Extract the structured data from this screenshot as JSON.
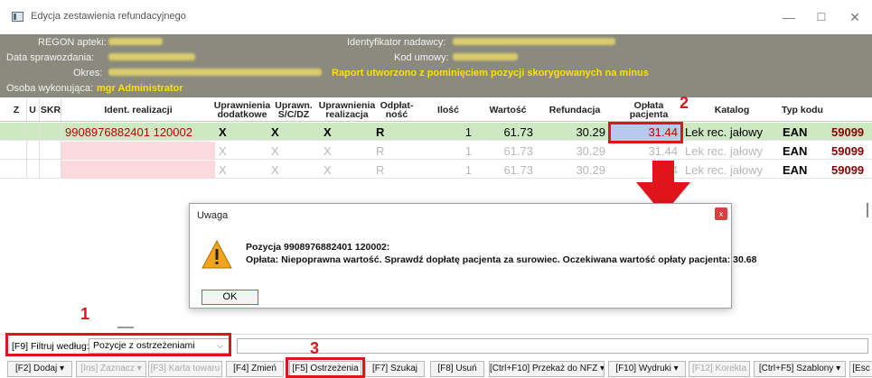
{
  "window": {
    "title": "Edycja zestawienia refundacyjnego",
    "minimize": "—",
    "maximize": "☐",
    "close": "✕"
  },
  "info": {
    "regon_label": "REGON apteki:",
    "data_label": "Data sprawozdania:",
    "okres_label": "Okres:",
    "okres_note": "Raport utworzono z pominięciem pozycji skorygowanych na minus",
    "osoba_label": "Osoba wykonująca:",
    "osoba_value": "mgr Administrator",
    "nadawca_label": "Identyfikator nadawcy:",
    "umowa_label": "Kod umowy:"
  },
  "grid": {
    "headers": {
      "z": "Z",
      "u": "U",
      "skr": "SKR",
      "ident": "Ident. realizacji",
      "upr_dod": "Uprawnienia dodatkowe",
      "upr_scdz": "Uprawn. S/C/DZ",
      "upr_real": "Uprawnienia realizacja",
      "odplat": "Odpłat-ność",
      "ilosc": "Ilość",
      "wartosc": "Wartość",
      "refundacja": "Refundacja",
      "oplata": "Opłata pacjenta",
      "katalog": "Katalog",
      "typ": "Typ kodu"
    },
    "rows": [
      {
        "ident": "9908976882401  120002",
        "upr_dod": "X",
        "upr_scdz": "X",
        "upr_real": "X",
        "odplat": "R",
        "ilosc": "1",
        "wartosc": "61.73",
        "refundacja": "30.29",
        "oplata": "31.44",
        "katalog": "Lek rec. jałowy",
        "typ": "EAN",
        "kod": "59099"
      },
      {
        "ident": "",
        "upr_dod": "X",
        "upr_scdz": "X",
        "upr_real": "X",
        "odplat": "R",
        "ilosc": "1",
        "wartosc": "61.73",
        "refundacja": "30.29",
        "oplata": "31.44",
        "katalog": "Lek rec. jałowy",
        "typ": "EAN",
        "kod": "59099"
      },
      {
        "ident": "",
        "upr_dod": "X",
        "upr_scdz": "X",
        "upr_real": "X",
        "odplat": "R",
        "ilosc": "1",
        "wartosc": "61.73",
        "refundacja": "30.29",
        "oplata": "4",
        "katalog": "Lek rec. jałowy",
        "typ": "EAN",
        "kod": "59099"
      }
    ]
  },
  "callouts": {
    "one": "1",
    "two": "2",
    "three": "3"
  },
  "dialog": {
    "title": "Uwaga",
    "close": "x",
    "line1": "Pozycja 9908976882401  120002:",
    "line2": "Opłata: Niepoprawna wartość. Sprawdź dopłatę pacjenta za surowiec. Oczekiwana wartość opłaty pacjenta: 30.68",
    "ok": "OK"
  },
  "filter": {
    "label": "[F9] Filtruj według:",
    "value": "Pozycje z ostrzeżeniami"
  },
  "toolbar": {
    "dodaj": "[F2] Dodaj ▾",
    "zaznacz": "[Ins] Zaznacz ▾",
    "karta": "[F3] Karta towaru",
    "zmien": "[F4] Zmień",
    "ostrzezenia": "[F5] Ostrzeżenia",
    "szukaj": "[F7] Szukaj",
    "usun": "[F8] Usuń",
    "przekaz": "[Ctrl+F10] Przekaż do NFZ ▾",
    "wydruki": "[F10] Wydruki ▾",
    "korekta": "[F12] Korekta",
    "szablony": "[Ctrl+F5] Szablony ▾",
    "esc": "[Esc"
  },
  "colors": {
    "highlight": "#e0141b",
    "selected_row": "#cfe8c4",
    "header_bg": "#8a8a7e",
    "accent_yellow": "#ffe000"
  }
}
